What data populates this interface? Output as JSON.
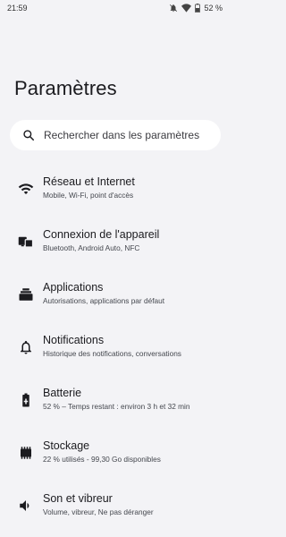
{
  "status_bar": {
    "time": "21:59",
    "battery_percent": "52 %",
    "icons": [
      "mute-notifications-icon",
      "wifi-icon",
      "battery-icon"
    ]
  },
  "page": {
    "title": "Paramètres"
  },
  "search": {
    "placeholder": "Rechercher dans les paramètres",
    "icon": "search-icon"
  },
  "items": [
    {
      "title": "Réseau et Internet",
      "subtitle": "Mobile, Wi-Fi, point d'accès",
      "icon": "wifi-icon"
    },
    {
      "title": "Connexion de l'appareil",
      "subtitle": "Bluetooth, Android Auto, NFC",
      "icon": "connected-devices-icon"
    },
    {
      "title": "Applications",
      "subtitle": "Autorisations, applications par défaut",
      "icon": "apps-icon"
    },
    {
      "title": "Notifications",
      "subtitle": "Historique des notifications, conversations",
      "icon": "bell-icon"
    },
    {
      "title": "Batterie",
      "subtitle": "52 % – Temps restant : environ 3 h et 32 min",
      "icon": "battery-icon"
    },
    {
      "title": "Stockage",
      "subtitle": "22 % utilisés - 99,30 Go disponibles",
      "icon": "storage-icon"
    },
    {
      "title": "Son et vibreur",
      "subtitle": "Volume, vibreur, Ne pas déranger",
      "icon": "volume-icon"
    }
  ],
  "colors": {
    "background": "#f3f3f6",
    "search_background": "#ffffff",
    "text_primary": "#1b1b1f",
    "text_secondary": "#44474e"
  }
}
